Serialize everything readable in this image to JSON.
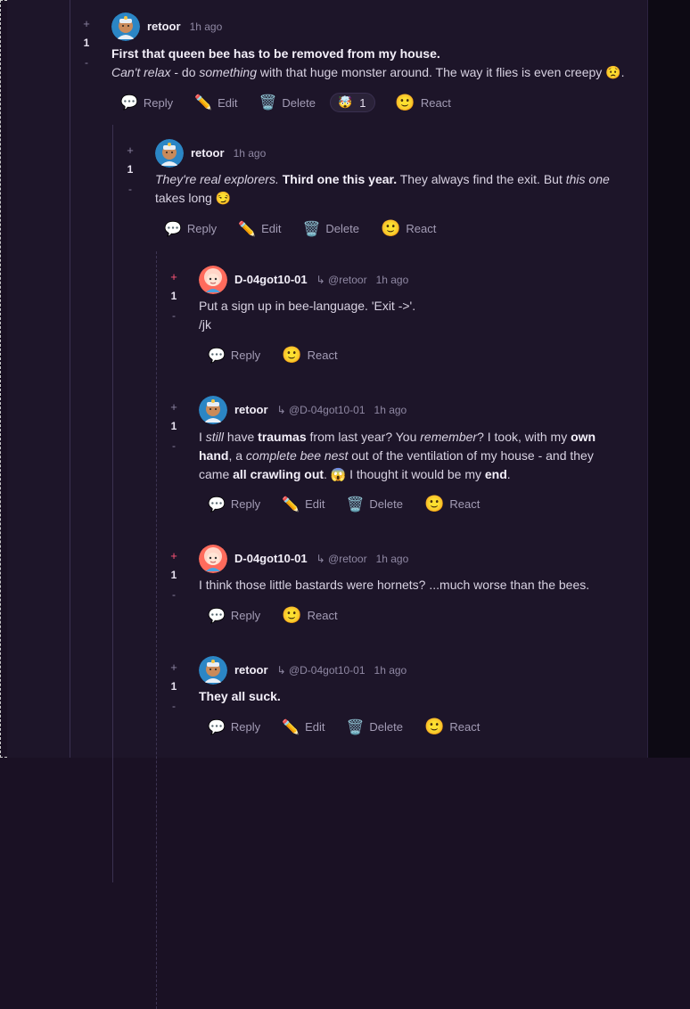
{
  "actions": {
    "reply": "Reply",
    "edit": "Edit",
    "delete": "Delete",
    "react": "React"
  },
  "vote": {
    "up": "+",
    "down": "-"
  },
  "comments": [
    {
      "author": "retoor",
      "time": "1h ago",
      "score": "1",
      "line1": "First that queen bee has to be removed from my house.",
      "reaction_emoji": "🤯",
      "reaction_count": "1"
    },
    {
      "author": "retoor",
      "time": "1h ago",
      "score": "1"
    },
    {
      "author": "D-04got10-01",
      "reply_to": "↳ @retoor",
      "time": "1h ago",
      "score": "1",
      "line1": "Put a sign up in bee-language. 'Exit ->'.",
      "line2": "/jk"
    },
    {
      "author": "retoor",
      "reply_to": "↳ @D-04got10-01",
      "time": "1h ago",
      "score": "1"
    },
    {
      "author": "D-04got10-01",
      "reply_to": "↳ @retoor",
      "time": "1h ago",
      "score": "1",
      "line1": "I think those little bastards were hornets? ...much worse than the bees."
    },
    {
      "author": "retoor",
      "reply_to": "↳ @D-04got10-01",
      "time": "1h ago",
      "score": "1",
      "line1": "They all suck."
    }
  ],
  "c1_line2": [
    {
      "t": "Can't relax",
      "s": "i"
    },
    {
      "t": " - do "
    },
    {
      "t": "something",
      "s": "i"
    },
    {
      "t": " with that huge monster around. The way it flies is even creepy 😟."
    }
  ],
  "c2_lines": [
    [
      {
        "t": "They're real explorers.",
        "s": "i"
      },
      {
        "t": " "
      },
      {
        "t": "Third one this year.",
        "s": "b"
      },
      {
        "t": " They always find the exit. But "
      },
      {
        "t": "this one",
        "s": "i"
      }
    ],
    [
      {
        "t": "takes long 😏"
      }
    ]
  ],
  "c4_lines": [
    [
      {
        "t": "I "
      },
      {
        "t": "still",
        "s": "i"
      },
      {
        "t": " have "
      },
      {
        "t": "traumas",
        "s": "b"
      },
      {
        "t": " from last year? You "
      },
      {
        "t": "remember",
        "s": "i"
      },
      {
        "t": "? I took, with my "
      },
      {
        "t": "own",
        "s": "b"
      }
    ],
    [
      {
        "t": "hand",
        "s": "b"
      },
      {
        "t": ", a "
      },
      {
        "t": "complete bee nest",
        "s": "i"
      },
      {
        "t": " out of the ventilation of my house - and they"
      }
    ],
    [
      {
        "t": "came "
      },
      {
        "t": "all crawling out",
        "s": "b"
      },
      {
        "t": ". 😱 I thought it would be my "
      },
      {
        "t": "end",
        "s": "b"
      },
      {
        "t": "."
      }
    ]
  ]
}
